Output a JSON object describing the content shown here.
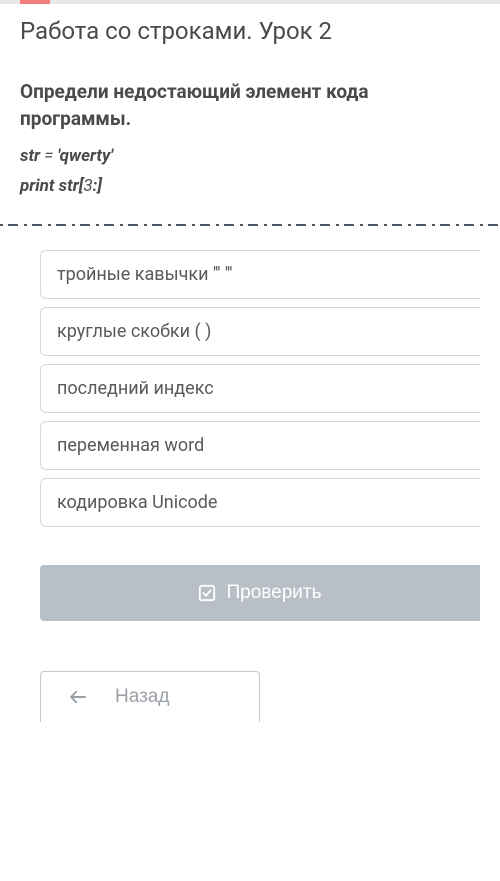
{
  "title": "Работа со строками. Урок 2",
  "question": "Определи недостающий элемент кода программы.",
  "code": {
    "line1_lhs": "str",
    "line1_eq": " = ",
    "line1_rhs": "'qwerty'",
    "line2_a": "print str[",
    "line2_b": "3",
    "line2_c": ":]"
  },
  "options": [
    "тройные кавычки ''' '''",
    "круглые скобки ( )",
    "последний индекс",
    "переменная word",
    "кодировка Unicode"
  ],
  "buttons": {
    "check": "Проверить",
    "back": "Назад"
  }
}
